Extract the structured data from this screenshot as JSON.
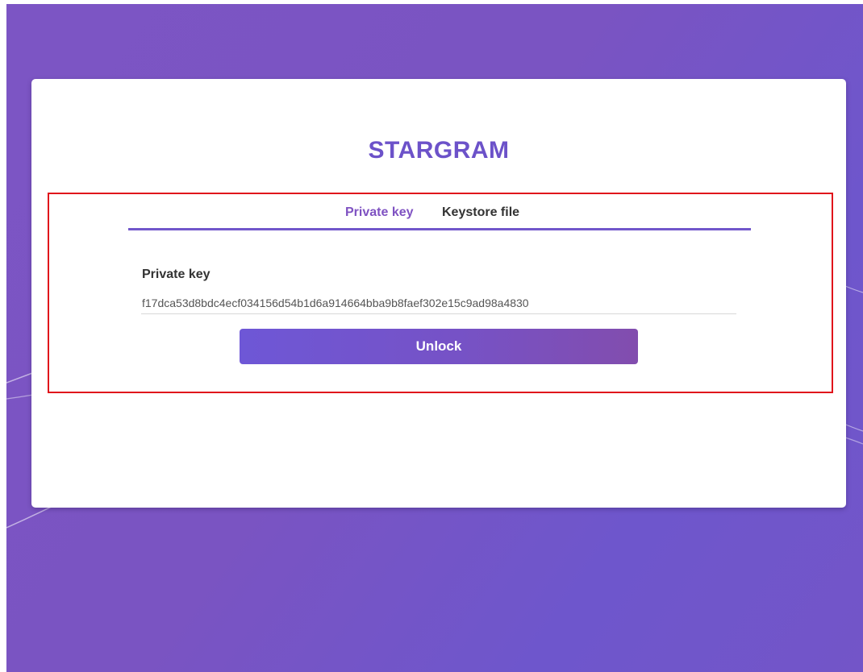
{
  "app": {
    "brand": "STARGRAM"
  },
  "tabs": [
    {
      "label": "Private key",
      "active": true
    },
    {
      "label": "Keystore file",
      "active": false
    }
  ],
  "form": {
    "label": "Private key",
    "value": "f17dca53d8bdc4ecf034156d54b1d6a914664bba9b8faef302e15c9ad98a4830"
  },
  "actions": {
    "unlock_label": "Unlock"
  },
  "colors": {
    "accent": "#6c52c9",
    "active_tab": "#7f52c2",
    "highlight_border": "#e0141b",
    "background": "#7a54c2"
  }
}
